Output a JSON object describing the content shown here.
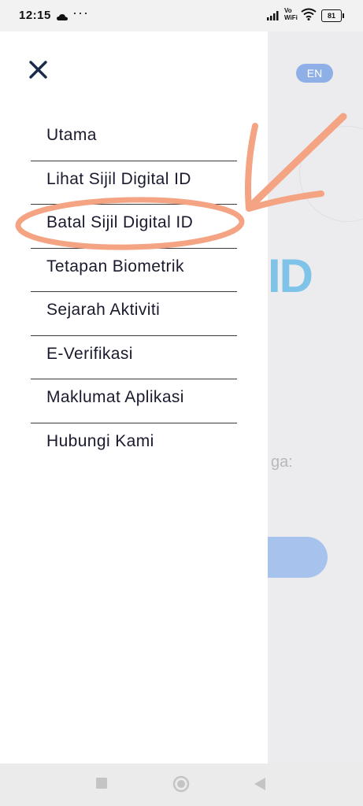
{
  "status_bar": {
    "time": "12:15",
    "more": "···",
    "vowifi_top": "Vo",
    "vowifi_bottom": "WiFi",
    "battery": "81"
  },
  "background": {
    "lang_toggle": "EN",
    "logo_fragment": "ID",
    "text_fragment": "ga:"
  },
  "drawer": {
    "menu_items": [
      {
        "label": "Utama"
      },
      {
        "label": "Lihat Sijil Digital ID"
      },
      {
        "label": "Batal Sijil Digital ID"
      },
      {
        "label": "Tetapan Biometrik"
      },
      {
        "label": "Sejarah Aktiviti"
      },
      {
        "label": "E-Verifikasi"
      },
      {
        "label": "Maklumat Aplikasi"
      },
      {
        "label": "Hubungi Kami"
      }
    ]
  },
  "colors": {
    "annotation": "#f4a383",
    "accent": "#8fb0e6",
    "text": "#1a1a2e"
  },
  "icons": {
    "close": "close-icon",
    "nav_recent": "square-icon",
    "nav_home": "circle-icon",
    "nav_back": "triangle-back-icon"
  }
}
